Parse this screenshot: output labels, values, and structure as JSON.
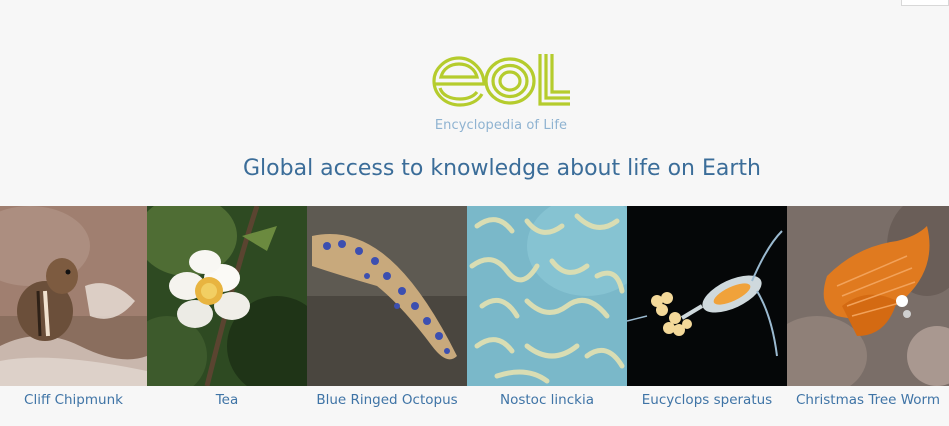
{
  "brand": {
    "logo_text": "eoL",
    "subtitle": "Encyclopedia of Life",
    "logo_color": "#b5cc2d"
  },
  "tagline": "Global access to knowledge about life on Earth",
  "colors": {
    "caption_link": "#3f74a6",
    "tagline": "#3b6d99",
    "background": "#f7f7f7"
  },
  "species": [
    {
      "name": "Cliff Chipmunk",
      "image": "chipmunk-photo"
    },
    {
      "name": "Tea",
      "image": "tea-flower-photo"
    },
    {
      "name": "Blue Ringed Octopus",
      "image": "octopus-photo"
    },
    {
      "name": "Nostoc linckia",
      "image": "cyanobacteria-photo"
    },
    {
      "name": "Eucyclops speratus",
      "image": "copepod-photo"
    },
    {
      "name": "Christmas Tree Worm",
      "image": "worm-photo"
    }
  ]
}
